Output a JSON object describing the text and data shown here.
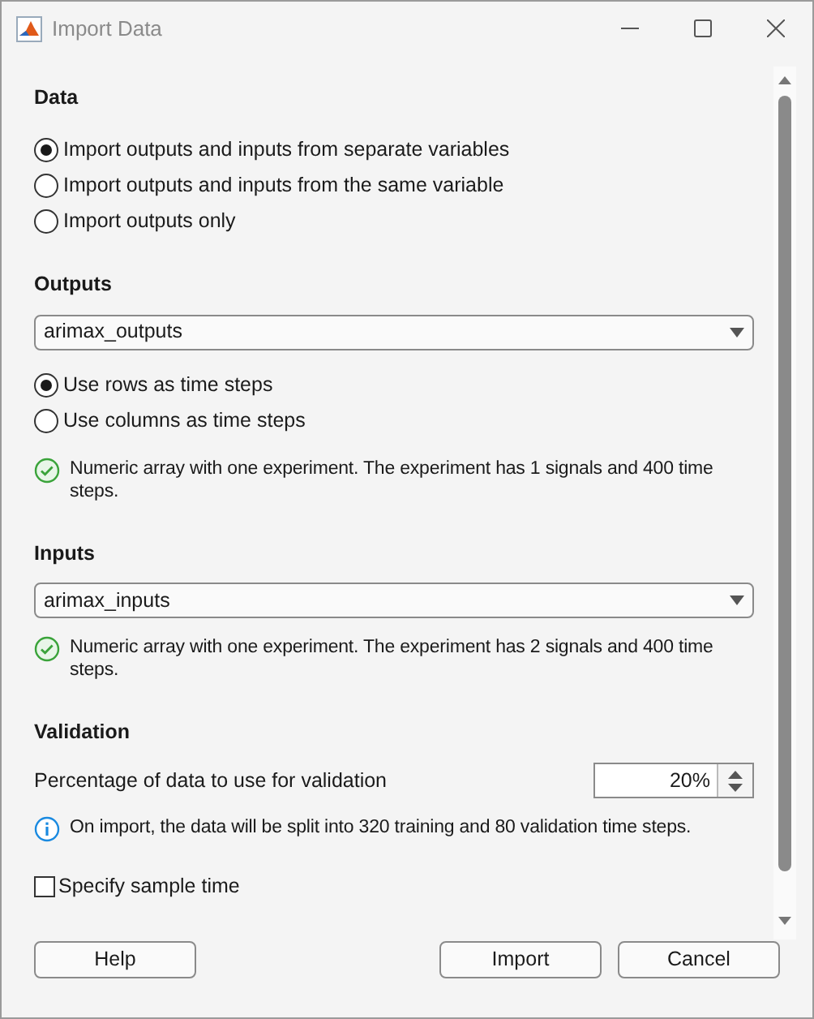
{
  "window": {
    "title": "Import Data"
  },
  "data_section": {
    "heading": "Data",
    "options": [
      {
        "label": "Import outputs and inputs from separate variables",
        "selected": true
      },
      {
        "label": "Import outputs and inputs from the same variable",
        "selected": false
      },
      {
        "label": "Import outputs only",
        "selected": false
      }
    ]
  },
  "outputs_section": {
    "heading": "Outputs",
    "variable": "arimax_outputs",
    "orientation": [
      {
        "label": "Use rows as time steps",
        "selected": true
      },
      {
        "label": "Use columns as time steps",
        "selected": false
      }
    ],
    "status": {
      "kind": "ok",
      "text": "Numeric array with one experiment. The experiment has 1 signals and 400 time steps."
    }
  },
  "inputs_section": {
    "heading": "Inputs",
    "variable": "arimax_inputs",
    "status": {
      "kind": "ok",
      "text": "Numeric array with one experiment. The experiment has 2 signals and 400 time steps."
    }
  },
  "validation_section": {
    "heading": "Validation",
    "percentage_label": "Percentage of data to use for validation",
    "percentage": "20%",
    "status": {
      "kind": "info",
      "text": "On import, the data will be split into 320 training and 80 validation time steps."
    }
  },
  "sample_time": {
    "label": "Specify sample time",
    "checked": false
  },
  "help_button": {
    "label": "Help"
  },
  "action_buttons": [
    {
      "label": "Import"
    },
    {
      "label": "Cancel"
    }
  ]
}
